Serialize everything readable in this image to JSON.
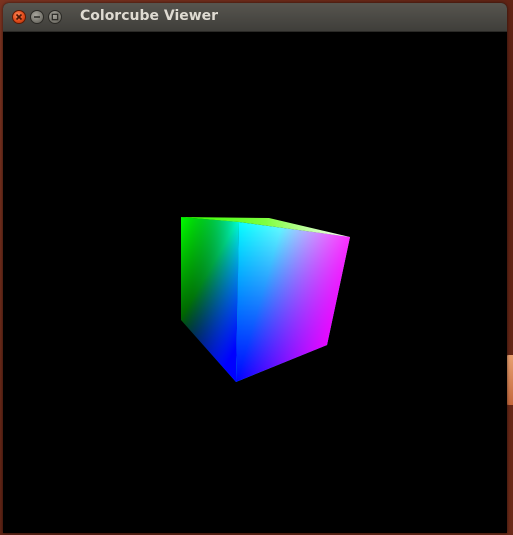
{
  "window": {
    "title": "Colorcube Viewer"
  },
  "titlebar_buttons": {
    "close_icon": "close-icon",
    "minimize_icon": "minimize-icon",
    "maximize_icon": "maximize-icon"
  },
  "viewport": {
    "background": "#000000",
    "object": "rgb-color-cube"
  },
  "colors": {
    "close": "#e04a1a",
    "titlebar": "#3f3e3a",
    "title_text": "#dfdbd2"
  }
}
